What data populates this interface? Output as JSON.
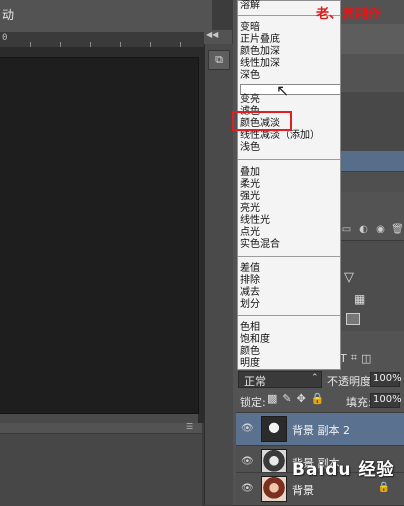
{
  "canvas": {
    "topbar_label": "动",
    "ruler_number": "0"
  },
  "watermark_title": "老、鼎制作",
  "blend_menu": {
    "groups": [
      {
        "items": [
          "溶解"
        ]
      },
      {
        "items": [
          "变暗",
          "正片叠底",
          "颜色加深",
          "线性加深",
          "深色"
        ]
      },
      {
        "items": [
          "变亮",
          "滤色",
          "颜色减淡",
          "线性减淡（添加）",
          "浅色"
        ]
      },
      {
        "items": [
          "叠加",
          "柔光",
          "强光",
          "亮光",
          "线性光",
          "点光",
          "实色混合"
        ]
      },
      {
        "items": [
          "差值",
          "排除",
          "减去",
          "划分"
        ]
      },
      {
        "items": [
          "色相",
          "饱和度",
          "颜色",
          "明度"
        ]
      }
    ],
    "highlighted_item": "颜色减淡"
  },
  "layers_panel": {
    "blend_mode_value": "正常",
    "opacity_label": "不透明度:",
    "opacity_value": "100%",
    "lock_label": "锁定:",
    "fill_label": "填充:",
    "fill_value": "100%",
    "layers": [
      {
        "name": "背景 副本 2",
        "selected": true
      },
      {
        "name": "背景 副本",
        "selected": false
      },
      {
        "name": "背景",
        "selected": false,
        "locked": true
      }
    ]
  },
  "watermark": "Baidu 经验",
  "icons": {
    "dock_icon": "layers-panel-icon",
    "eye": "eye-icon",
    "cursor": "mouse-cursor-icon"
  },
  "colors": {
    "selected_layer": "#5a7190",
    "highlight_box": "#e02020",
    "title_red": "#e01818"
  }
}
